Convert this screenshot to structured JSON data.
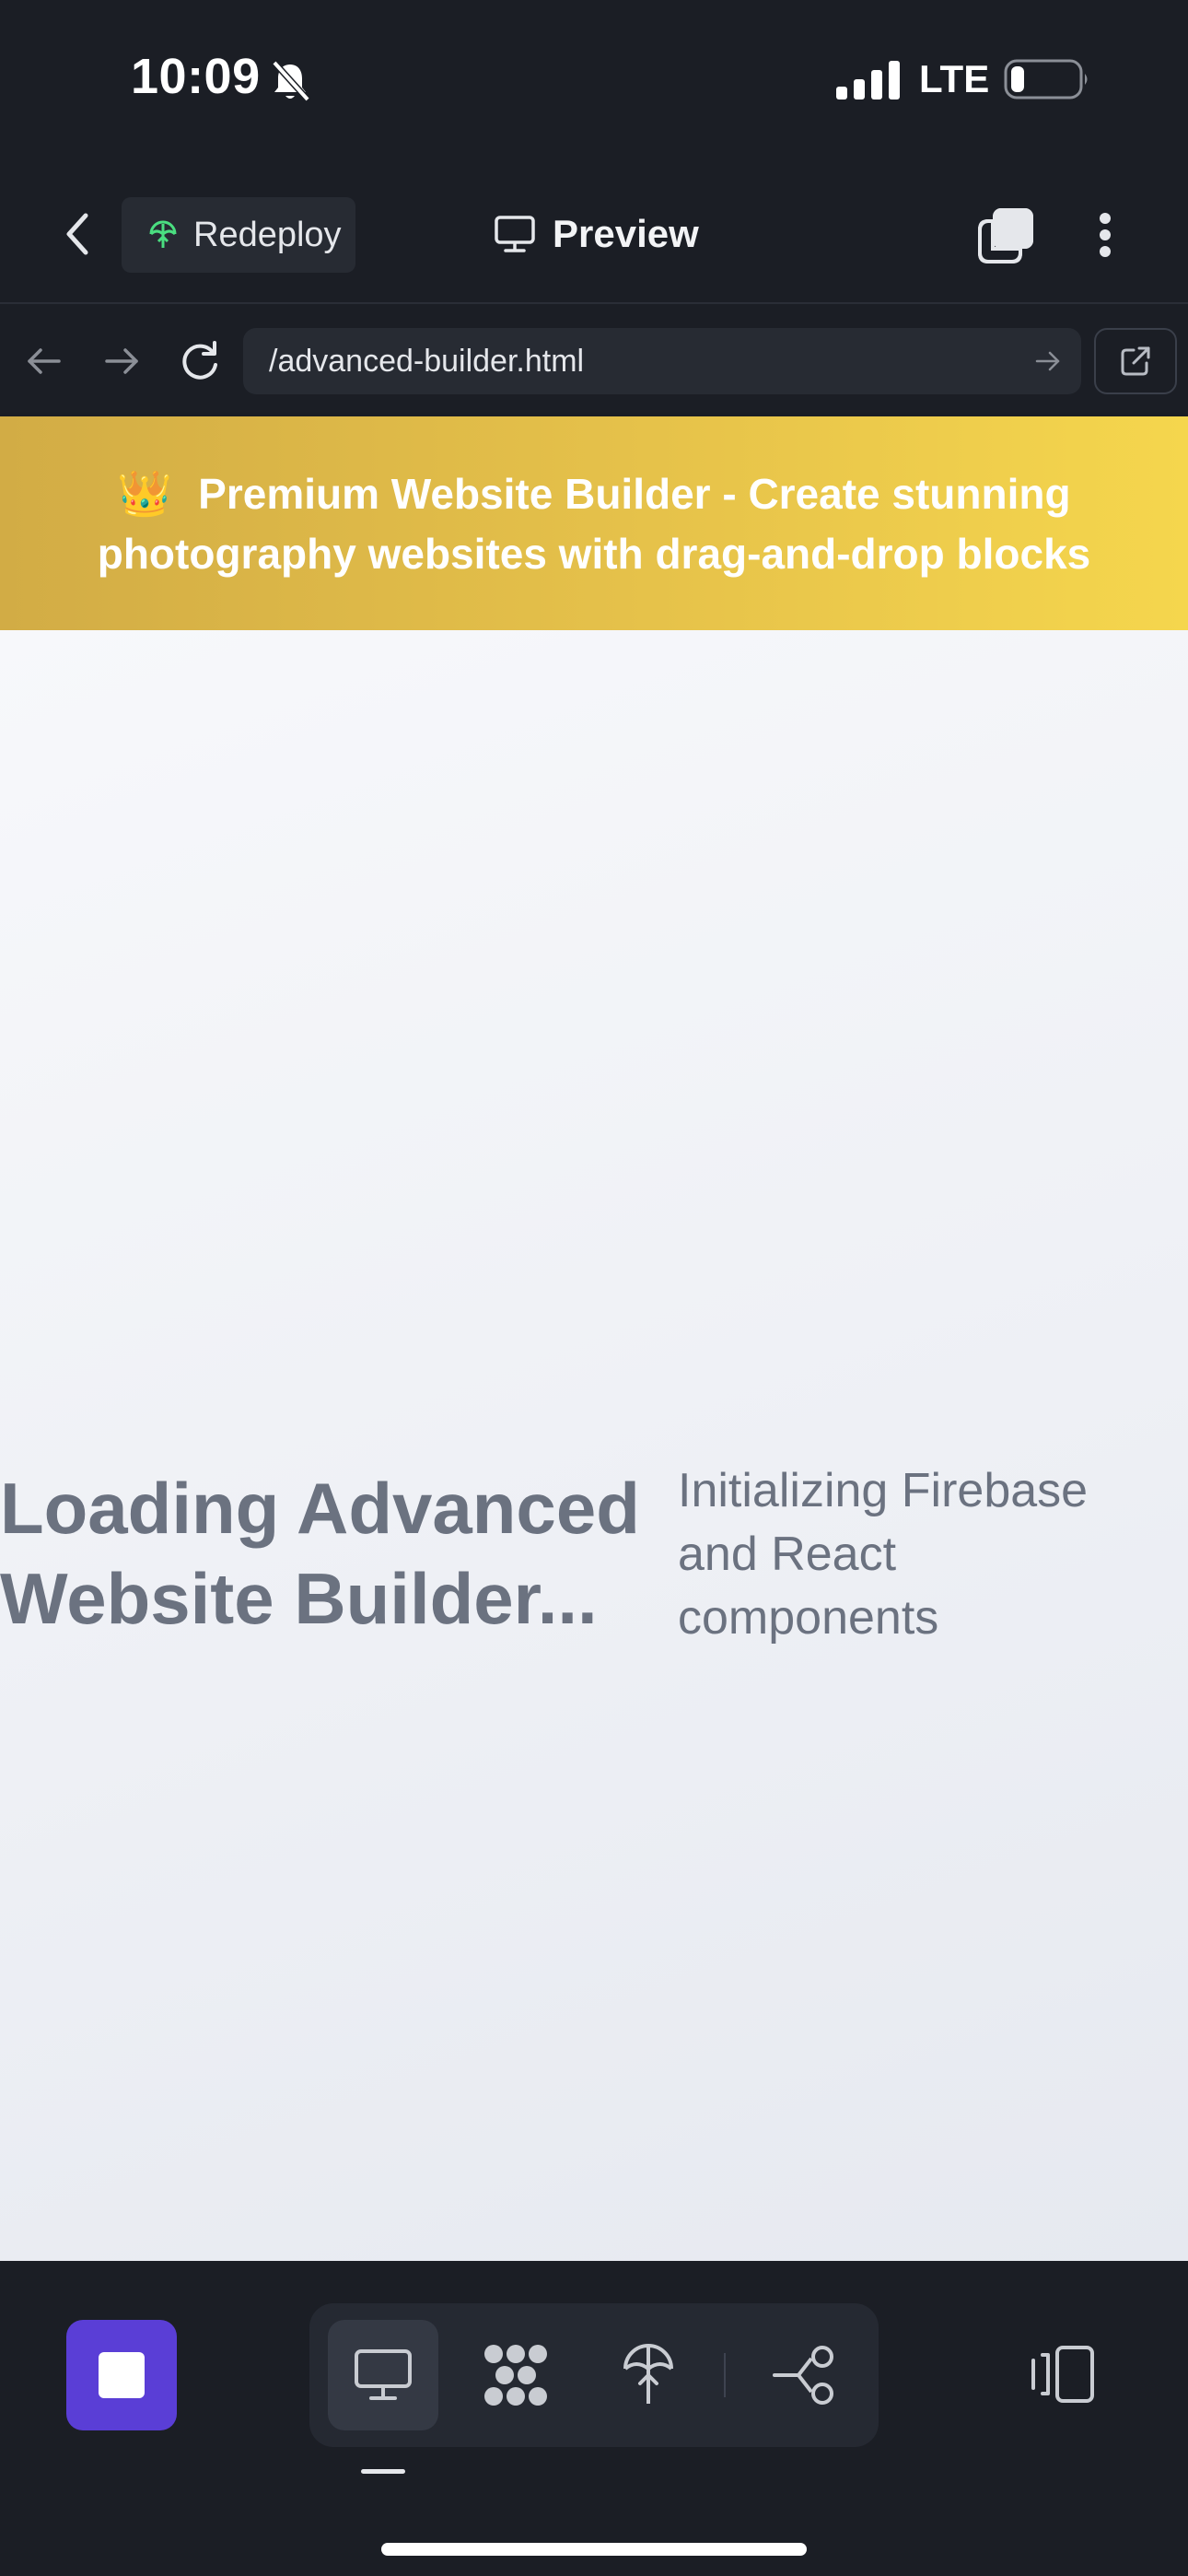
{
  "status_bar": {
    "time": "10:09",
    "network": "LTE",
    "bell_icon": "bell-slash-icon",
    "battery_level": 0.15
  },
  "header": {
    "redeploy_label": "Redeploy",
    "title": "Preview"
  },
  "url_bar": {
    "url": "/advanced-builder.html"
  },
  "banner": {
    "crown": "👑",
    "text": "Premium Website Builder - Create stunning photography websites with drag-and-drop blocks",
    "colors": [
      "#d2ac45",
      "#f5d64d"
    ]
  },
  "main": {
    "loading_title": "Loading Advanced Website Builder...",
    "loading_subtitle": "Initializing Firebase and React components"
  },
  "toolbar": {
    "stop_color": "#5a3ed6",
    "tools": [
      "monitor-icon",
      "workflow-icon",
      "deploy-icon",
      "share-icon"
    ],
    "active_tool": "monitor-icon"
  }
}
